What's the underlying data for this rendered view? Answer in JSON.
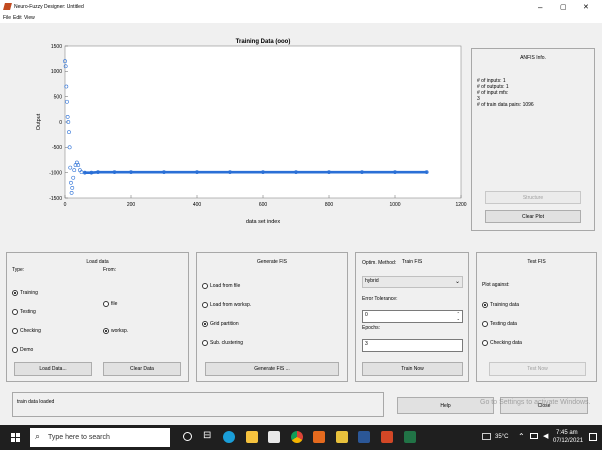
{
  "window": {
    "title": "Neuro-Fuzzy Designer: Untitled",
    "min": "–",
    "max": "▢",
    "close": "✕"
  },
  "menu": [
    "File",
    "Edit",
    "View"
  ],
  "plot": {
    "title": "Training Data (ooo)",
    "ylabel": "Output",
    "xlabel": "data set index",
    "xticks": [
      "0",
      "200",
      "400",
      "600",
      "800",
      "1000",
      "1200"
    ],
    "yticks": [
      "1500",
      "1000",
      "500",
      "0",
      "-500",
      "-1000",
      "-1500"
    ]
  },
  "chart_data": {
    "type": "scatter",
    "title": "Training Data (ooo)",
    "xlabel": "data set index",
    "ylabel": "Output",
    "xlim": [
      0,
      1200
    ],
    "ylim": [
      -1500,
      1500
    ],
    "series": [
      {
        "x": [
          0,
          2,
          4,
          6,
          8,
          10,
          12,
          14,
          16,
          18,
          20,
          22,
          25,
          28,
          32,
          36,
          40,
          45,
          50,
          60,
          80,
          100,
          150,
          200,
          300,
          400,
          500,
          600,
          700,
          800,
          900,
          1000,
          1096
        ],
        "y": [
          1200,
          1100,
          700,
          400,
          100,
          0,
          -200,
          -500,
          -900,
          -1200,
          -1400,
          -1300,
          -1100,
          -950,
          -850,
          -800,
          -850,
          -950,
          -990,
          -1000,
          -1000,
          -990,
          -990,
          -990,
          -990,
          -990,
          -990,
          -990,
          -990,
          -990,
          -990,
          -990,
          -990
        ]
      }
    ]
  },
  "anfis": {
    "title": "ANFIS Info.",
    "lines": [
      "# of inputs: 1",
      "# of outputs: 1",
      "# of input mfs:",
      "3",
      "# of train data pairs: 1096"
    ],
    "structure": "Structure",
    "clear": "Clear Plot"
  },
  "load": {
    "title": "Load data",
    "type_label": "Type:",
    "from_label": "From:",
    "types": [
      "Training",
      "Testing",
      "Checking",
      "Demo"
    ],
    "froms": [
      "file",
      "worksp."
    ],
    "load_btn": "Load Data...",
    "clear_btn": "Clear Data"
  },
  "generate": {
    "title": "Generate FIS",
    "options": [
      "Load from file",
      "Load from worksp.",
      "Grid partition",
      "Sub. clustering"
    ],
    "btn": "Generate FIS ..."
  },
  "train": {
    "title": "Train FIS",
    "optim_label": "Optim. Method:",
    "optim_value": "hybrid",
    "tol_label": "Error Tolerance:",
    "tol_value": "0",
    "epochs_label": "Epochs:",
    "epochs_value": "3",
    "btn": "Train Now"
  },
  "test": {
    "title": "Test FIS",
    "plot_against": "Plot against:",
    "options": [
      "Training data",
      "Testing data",
      "Checking data"
    ],
    "btn": "Test Now"
  },
  "status": {
    "text": "train data loaded",
    "help": "Help",
    "close": "Close",
    "watermark": "Go to Settings to activate Windows."
  },
  "taskbar": {
    "search": "Type here to search",
    "temp": "35°C",
    "time": "7:45 am",
    "date": "07/12/2021"
  }
}
